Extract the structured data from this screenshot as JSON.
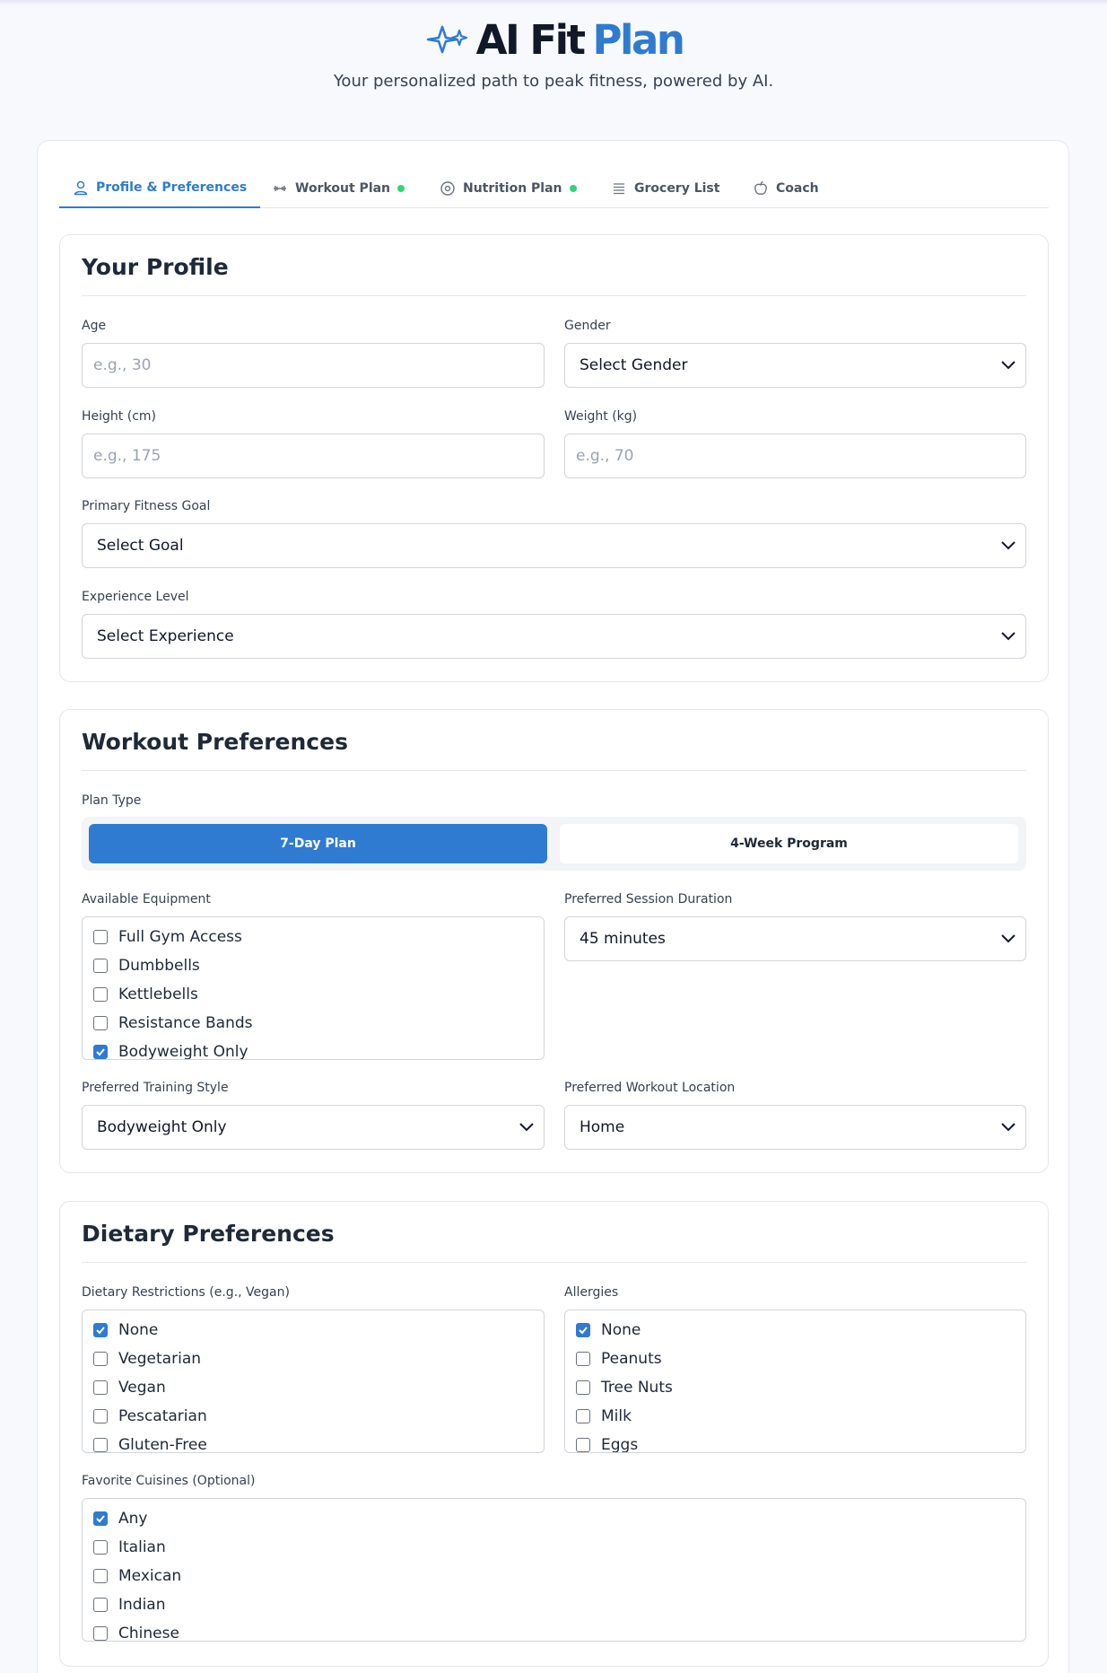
{
  "app": {
    "title_ai": "AI Fit",
    "title_plan": "Plan",
    "tagline": "Your personalized path to peak fitness, powered by AI."
  },
  "tabs": [
    {
      "label": "Profile & Preferences",
      "icon": "user-icon",
      "active": true
    },
    {
      "label": "Workout Plan",
      "icon": "dumbbell-icon",
      "status_dot": true
    },
    {
      "label": "Nutrition Plan",
      "icon": "plate-icon",
      "status_dot": true
    },
    {
      "label": "Grocery List",
      "icon": "list-icon"
    },
    {
      "label": "Coach",
      "icon": "apple-icon"
    }
  ],
  "profile": {
    "title": "Your Profile",
    "age_label": "Age",
    "age_placeholder": "e.g., 30",
    "gender_label": "Gender",
    "gender_value": "Select Gender",
    "height_label": "Height (cm)",
    "height_placeholder": "e.g., 175",
    "weight_label": "Weight (kg)",
    "weight_placeholder": "e.g., 70",
    "goal_label": "Primary Fitness Goal",
    "goal_value": "Select Goal",
    "experience_label": "Experience Level",
    "experience_value": "Select Experience"
  },
  "workout": {
    "title": "Workout Preferences",
    "plan_type_label": "Plan Type",
    "plan_options": [
      "7-Day Plan",
      "4-Week Program"
    ],
    "plan_selected": "7-Day Plan",
    "equipment_label": "Available Equipment",
    "equipment": [
      {
        "label": "Full Gym Access",
        "checked": false
      },
      {
        "label": "Dumbbells",
        "checked": false
      },
      {
        "label": "Kettlebells",
        "checked": false
      },
      {
        "label": "Resistance Bands",
        "checked": false
      },
      {
        "label": "Bodyweight Only",
        "checked": true
      }
    ],
    "duration_label": "Preferred Session Duration",
    "duration_value": "45 minutes",
    "style_label": "Preferred Training Style",
    "style_value": "Bodyweight Only",
    "location_label": "Preferred Workout Location",
    "location_value": "Home"
  },
  "diet": {
    "title": "Dietary Preferences",
    "restrictions_label": "Dietary Restrictions (e.g., Vegan)",
    "restrictions": [
      {
        "label": "None",
        "checked": true
      },
      {
        "label": "Vegetarian",
        "checked": false
      },
      {
        "label": "Vegan",
        "checked": false
      },
      {
        "label": "Pescatarian",
        "checked": false
      },
      {
        "label": "Gluten-Free",
        "checked": false
      }
    ],
    "allergies_label": "Allergies",
    "allergies": [
      {
        "label": "None",
        "checked": true
      },
      {
        "label": "Peanuts",
        "checked": false
      },
      {
        "label": "Tree Nuts",
        "checked": false
      },
      {
        "label": "Milk",
        "checked": false
      },
      {
        "label": "Eggs",
        "checked": false
      }
    ],
    "cuisines_label": "Favorite Cuisines (Optional)",
    "cuisines": [
      {
        "label": "Any",
        "checked": true
      },
      {
        "label": "Italian",
        "checked": false
      },
      {
        "label": "Mexican",
        "checked": false
      },
      {
        "label": "Indian",
        "checked": false
      },
      {
        "label": "Chinese",
        "checked": false
      }
    ]
  },
  "colors": {
    "accent": "#2f7bd1",
    "status_dot": "#34d27a"
  }
}
